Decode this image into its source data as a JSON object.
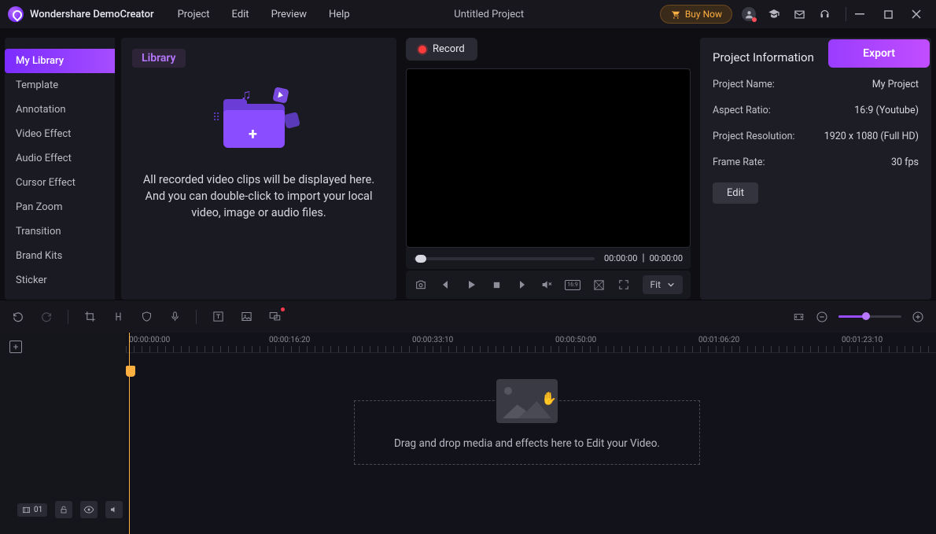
{
  "titlebar": {
    "appname": "Wondershare DemoCreator",
    "menu": [
      "Project",
      "Edit",
      "Preview",
      "Help"
    ],
    "project_title": "Untitled Project",
    "buy_label": "Buy Now"
  },
  "sidebar": {
    "items": [
      {
        "label": "My Library",
        "active": true
      },
      {
        "label": "Template"
      },
      {
        "label": "Annotation"
      },
      {
        "label": "Video Effect"
      },
      {
        "label": "Audio Effect"
      },
      {
        "label": "Cursor Effect"
      },
      {
        "label": "Pan Zoom"
      },
      {
        "label": "Transition"
      },
      {
        "label": "Brand Kits"
      },
      {
        "label": "Sticker"
      }
    ]
  },
  "library": {
    "tag": "Library",
    "description": "All recorded video clips will be displayed here. And you can double-click to import your local video, image or audio files."
  },
  "preview": {
    "record_label": "Record",
    "current_time": "00:00:00",
    "total_time": "00:00:00",
    "fit_label": "Fit"
  },
  "export_label": "Export",
  "info": {
    "title": "Project Information",
    "rows": [
      {
        "label": "Project Name:",
        "value": "My Project"
      },
      {
        "label": "Aspect Ratio:",
        "value": "16:9 (Youtube)"
      },
      {
        "label": "Project Resolution:",
        "value": "1920 x 1080 (Full HD)"
      },
      {
        "label": "Frame Rate:",
        "value": "30 fps"
      }
    ],
    "edit_label": "Edit"
  },
  "timeline": {
    "ruler": [
      "00:00:00:00",
      "00:00:16:20",
      "00:00:33:10",
      "00:00:50:00",
      "00:01:06:20",
      "00:01:23:10"
    ],
    "track_number": "01",
    "dropzone_text": "Drag and drop media and effects here to Edit your Video."
  }
}
